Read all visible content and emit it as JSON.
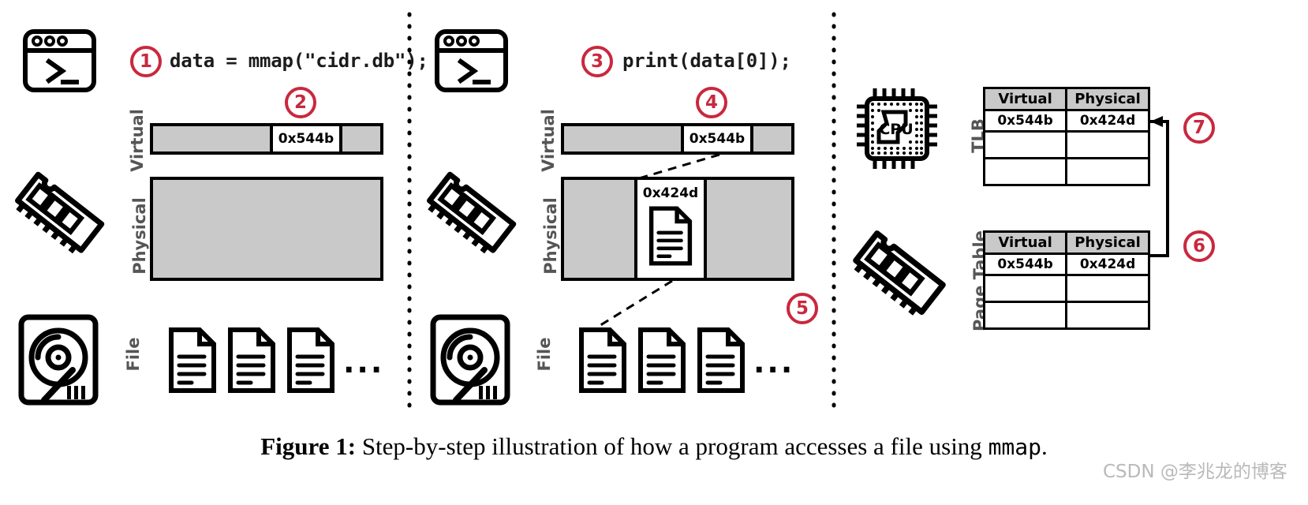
{
  "figure": {
    "caption_label": "Figure 1:",
    "caption_text": " Step-by-step illustration of how a program accesses a file using ",
    "caption_mono": "mmap",
    "caption_end": ".",
    "watermark": "CSDN @李兆龙的博客"
  },
  "colors": {
    "accent_red": "#c9283e",
    "fill_gray": "#c9c9c9",
    "stroke_black": "#000000",
    "label_gray": "#555555"
  },
  "panels": {
    "left": {
      "name": "mmap-call-panel",
      "terminal_icon": "terminal-icon",
      "ram_icon": "ram-stick-icon",
      "disk_icon": "hard-disk-icon",
      "step1": "1",
      "step2": "2",
      "code": "data = mmap(\"cidr.db\");",
      "virtual_label": "Virtual",
      "physical_label": "Physical",
      "file_label": "File",
      "virtual_segment_value": "0x544b",
      "file_ellipsis": "...",
      "file_icons": [
        "document-icon",
        "document-icon",
        "document-icon"
      ]
    },
    "middle": {
      "name": "page-fault-panel",
      "terminal_icon": "terminal-icon",
      "ram_icon": "ram-stick-icon",
      "disk_icon": "hard-disk-icon",
      "step3": "3",
      "step4": "4",
      "step5": "5",
      "code": "print(data[0]);",
      "virtual_label": "Virtual",
      "physical_label": "Physical",
      "file_label": "File",
      "virtual_segment_value": "0x544b",
      "physical_segment_value": "0x424d",
      "physical_page_icon": "document-icon",
      "file_ellipsis": "...",
      "file_icons": [
        "document-icon",
        "document-icon",
        "document-icon"
      ]
    },
    "right": {
      "name": "translation-panel",
      "cpu_icon": "cpu-chip-icon",
      "ram_icon": "ram-stick-icon",
      "step6": "6",
      "step7": "7",
      "tlb": {
        "label": "TLB",
        "columns": [
          "Virtual",
          "Physical"
        ],
        "rows": [
          [
            "0x544b",
            "0x424d"
          ],
          [
            "",
            ""
          ],
          [
            "",
            ""
          ]
        ]
      },
      "page_table": {
        "label": "Page Table",
        "columns": [
          "Virtual",
          "Physical"
        ],
        "rows": [
          [
            "0x544b",
            "0x424d"
          ],
          [
            "",
            ""
          ],
          [
            "",
            ""
          ]
        ]
      }
    }
  }
}
